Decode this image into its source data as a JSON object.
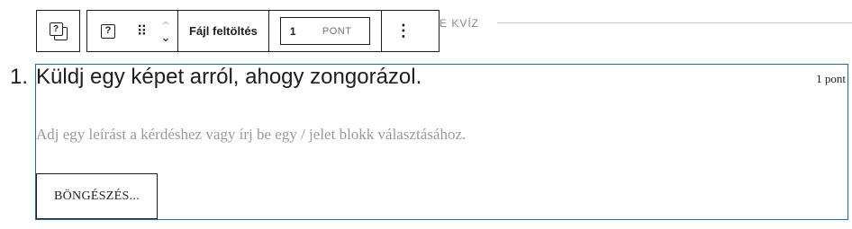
{
  "heading": {
    "text": "E KVÍZ"
  },
  "toolbar": {
    "parent_icon": "?",
    "block_icon": "?",
    "drag_handle": "⠿",
    "move_up": "⌃",
    "move_down": "⌄",
    "block_label": "Fájl feltöltés",
    "points_value": "1",
    "points_unit": "PONT",
    "more_options": "⋮"
  },
  "question": {
    "number": "1.",
    "title": "Küldj egy képet arról, ahogy zongorázol.",
    "points": "1 pont",
    "description": "Adj egy leírást a kérdéshez vagy írj be egy / jelet blokk választásához.",
    "browse_button": "BÖNGÉSZÉS..."
  }
}
